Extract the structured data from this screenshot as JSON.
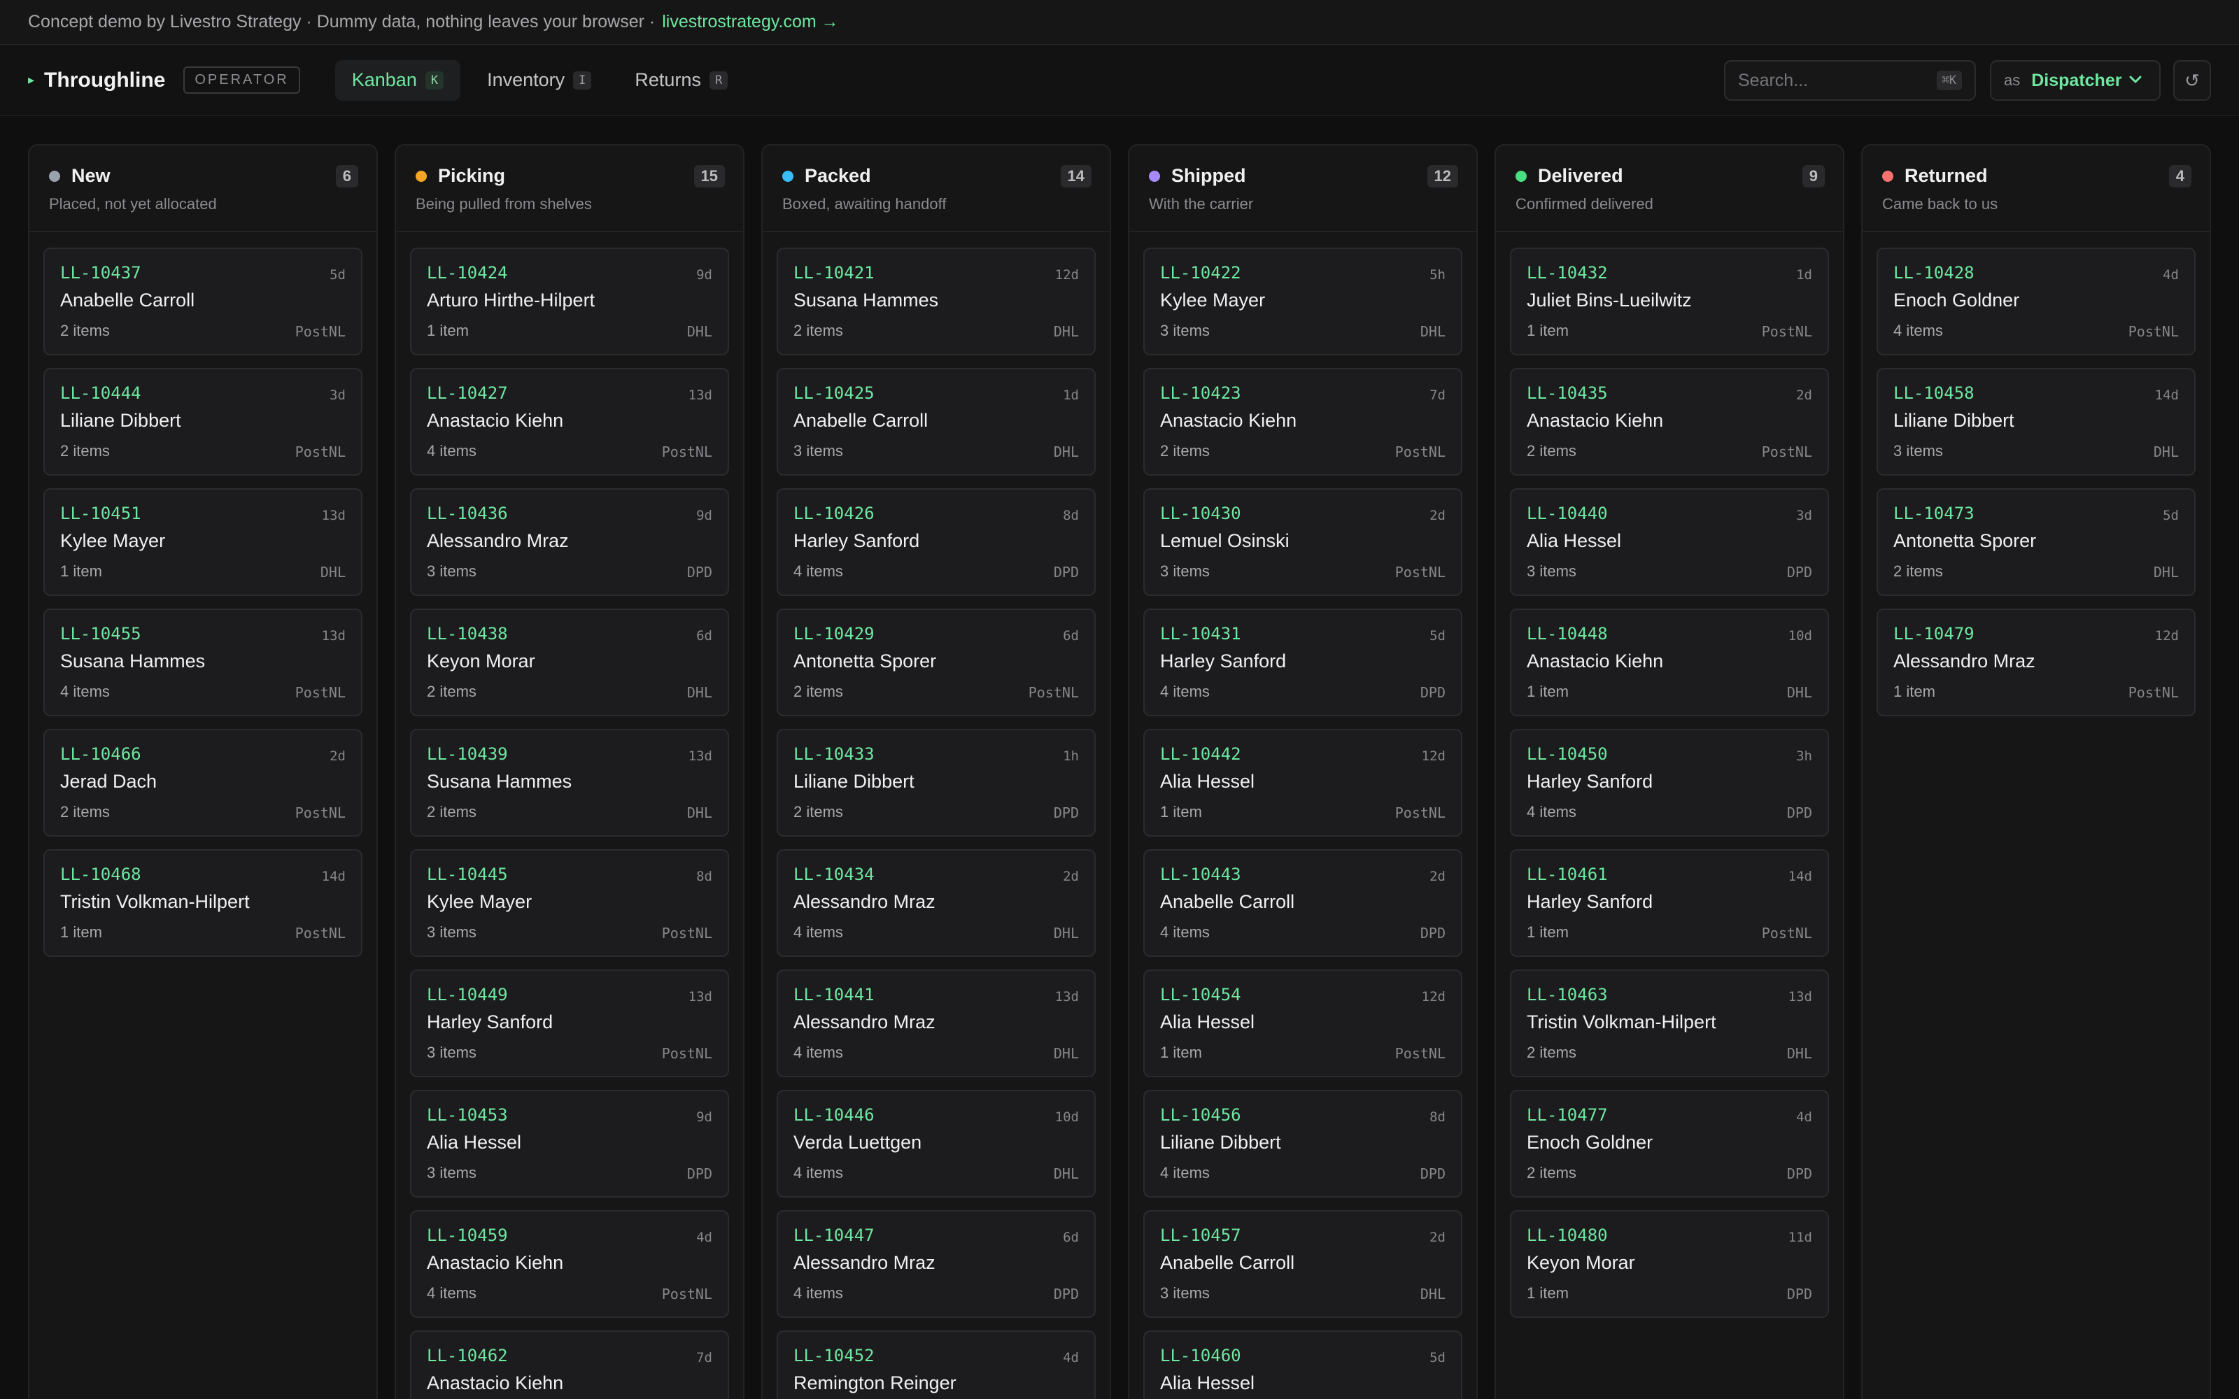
{
  "banner": {
    "text": "Concept demo by Livestro Strategy · Dummy data, nothing leaves your browser ·",
    "link": "livestrostrategy.com →"
  },
  "header": {
    "brand": "Throughline",
    "role_badge": "OPERATOR",
    "tabs": [
      {
        "label": "Kanban",
        "shortcut": "K",
        "active": true
      },
      {
        "label": "Inventory",
        "shortcut": "I",
        "active": false
      },
      {
        "label": "Returns",
        "shortcut": "R",
        "active": false
      }
    ],
    "search": {
      "placeholder": "Search...",
      "shortcut": "⌘K"
    },
    "role_select": {
      "prefix": "as",
      "value": "Dispatcher"
    },
    "refresh_icon": "↺"
  },
  "colors": {
    "accent": "#6ee7a0",
    "new": "#9aa3ad",
    "picking": "#f5a524",
    "packed": "#38bdf8",
    "shipped": "#a78bfa",
    "delivered": "#4ade80",
    "returned": "#f87171"
  },
  "columns": [
    {
      "title": "New",
      "count": "6",
      "subtitle": "Placed, not yet allocated",
      "color": "#9aa3ad",
      "cards": [
        {
          "id": "LL-10437",
          "age": "5d",
          "name": "Anabelle Carroll",
          "items": "2 items",
          "carrier": "PostNL"
        },
        {
          "id": "LL-10444",
          "age": "3d",
          "name": "Liliane Dibbert",
          "items": "2 items",
          "carrier": "PostNL"
        },
        {
          "id": "LL-10451",
          "age": "13d",
          "name": "Kylee Mayer",
          "items": "1 item",
          "carrier": "DHL"
        },
        {
          "id": "LL-10455",
          "age": "13d",
          "name": "Susana Hammes",
          "items": "4 items",
          "carrier": "PostNL"
        },
        {
          "id": "LL-10466",
          "age": "2d",
          "name": "Jerad Dach",
          "items": "2 items",
          "carrier": "PostNL"
        },
        {
          "id": "LL-10468",
          "age": "14d",
          "name": "Tristin Volkman-Hilpert",
          "items": "1 item",
          "carrier": "PostNL"
        }
      ]
    },
    {
      "title": "Picking",
      "count": "15",
      "subtitle": "Being pulled from shelves",
      "color": "#f5a524",
      "cards": [
        {
          "id": "LL-10424",
          "age": "9d",
          "name": "Arturo Hirthe-Hilpert",
          "items": "1 item",
          "carrier": "DHL"
        },
        {
          "id": "LL-10427",
          "age": "13d",
          "name": "Anastacio Kiehn",
          "items": "4 items",
          "carrier": "PostNL"
        },
        {
          "id": "LL-10436",
          "age": "9d",
          "name": "Alessandro Mraz",
          "items": "3 items",
          "carrier": "DPD"
        },
        {
          "id": "LL-10438",
          "age": "6d",
          "name": "Keyon Morar",
          "items": "2 items",
          "carrier": "DHL"
        },
        {
          "id": "LL-10439",
          "age": "13d",
          "name": "Susana Hammes",
          "items": "2 items",
          "carrier": "DHL"
        },
        {
          "id": "LL-10445",
          "age": "8d",
          "name": "Kylee Mayer",
          "items": "3 items",
          "carrier": "PostNL"
        },
        {
          "id": "LL-10449",
          "age": "13d",
          "name": "Harley Sanford",
          "items": "3 items",
          "carrier": "PostNL"
        },
        {
          "id": "LL-10453",
          "age": "9d",
          "name": "Alia Hessel",
          "items": "3 items",
          "carrier": "DPD"
        },
        {
          "id": "LL-10459",
          "age": "4d",
          "name": "Anastacio Kiehn",
          "items": "4 items",
          "carrier": "PostNL"
        },
        {
          "id": "LL-10462",
          "age": "7d",
          "name": "Anastacio Kiehn",
          "items": "",
          "carrier": ""
        }
      ]
    },
    {
      "title": "Packed",
      "count": "14",
      "subtitle": "Boxed, awaiting handoff",
      "color": "#38bdf8",
      "cards": [
        {
          "id": "LL-10421",
          "age": "12d",
          "name": "Susana Hammes",
          "items": "2 items",
          "carrier": "DHL"
        },
        {
          "id": "LL-10425",
          "age": "1d",
          "name": "Anabelle Carroll",
          "items": "3 items",
          "carrier": "DHL"
        },
        {
          "id": "LL-10426",
          "age": "8d",
          "name": "Harley Sanford",
          "items": "4 items",
          "carrier": "DPD"
        },
        {
          "id": "LL-10429",
          "age": "6d",
          "name": "Antonetta Sporer",
          "items": "2 items",
          "carrier": "PostNL"
        },
        {
          "id": "LL-10433",
          "age": "1h",
          "name": "Liliane Dibbert",
          "items": "2 items",
          "carrier": "DPD"
        },
        {
          "id": "LL-10434",
          "age": "2d",
          "name": "Alessandro Mraz",
          "items": "4 items",
          "carrier": "DHL"
        },
        {
          "id": "LL-10441",
          "age": "13d",
          "name": "Alessandro Mraz",
          "items": "4 items",
          "carrier": "DHL"
        },
        {
          "id": "LL-10446",
          "age": "10d",
          "name": "Verda Luettgen",
          "items": "4 items",
          "carrier": "DHL"
        },
        {
          "id": "LL-10447",
          "age": "6d",
          "name": "Alessandro Mraz",
          "items": "4 items",
          "carrier": "DPD"
        },
        {
          "id": "LL-10452",
          "age": "4d",
          "name": "Remington Reinger",
          "items": "",
          "carrier": ""
        }
      ]
    },
    {
      "title": "Shipped",
      "count": "12",
      "subtitle": "With the carrier",
      "color": "#a78bfa",
      "cards": [
        {
          "id": "LL-10422",
          "age": "5h",
          "name": "Kylee Mayer",
          "items": "3 items",
          "carrier": "DHL"
        },
        {
          "id": "LL-10423",
          "age": "7d",
          "name": "Anastacio Kiehn",
          "items": "2 items",
          "carrier": "PostNL"
        },
        {
          "id": "LL-10430",
          "age": "2d",
          "name": "Lemuel Osinski",
          "items": "3 items",
          "carrier": "PostNL"
        },
        {
          "id": "LL-10431",
          "age": "5d",
          "name": "Harley Sanford",
          "items": "4 items",
          "carrier": "DPD"
        },
        {
          "id": "LL-10442",
          "age": "12d",
          "name": "Alia Hessel",
          "items": "1 item",
          "carrier": "PostNL"
        },
        {
          "id": "LL-10443",
          "age": "2d",
          "name": "Anabelle Carroll",
          "items": "4 items",
          "carrier": "DPD"
        },
        {
          "id": "LL-10454",
          "age": "12d",
          "name": "Alia Hessel",
          "items": "1 item",
          "carrier": "PostNL"
        },
        {
          "id": "LL-10456",
          "age": "8d",
          "name": "Liliane Dibbert",
          "items": "4 items",
          "carrier": "DPD"
        },
        {
          "id": "LL-10457",
          "age": "2d",
          "name": "Anabelle Carroll",
          "items": "3 items",
          "carrier": "DHL"
        },
        {
          "id": "LL-10460",
          "age": "5d",
          "name": "Alia Hessel",
          "items": "",
          "carrier": ""
        }
      ]
    },
    {
      "title": "Delivered",
      "count": "9",
      "subtitle": "Confirmed delivered",
      "color": "#4ade80",
      "cards": [
        {
          "id": "LL-10432",
          "age": "1d",
          "name": "Juliet Bins-Lueilwitz",
          "items": "1 item",
          "carrier": "PostNL"
        },
        {
          "id": "LL-10435",
          "age": "2d",
          "name": "Anastacio Kiehn",
          "items": "2 items",
          "carrier": "PostNL"
        },
        {
          "id": "LL-10440",
          "age": "3d",
          "name": "Alia Hessel",
          "items": "3 items",
          "carrier": "DPD"
        },
        {
          "id": "LL-10448",
          "age": "10d",
          "name": "Anastacio Kiehn",
          "items": "1 item",
          "carrier": "DHL"
        },
        {
          "id": "LL-10450",
          "age": "3h",
          "name": "Harley Sanford",
          "items": "4 items",
          "carrier": "DPD"
        },
        {
          "id": "LL-10461",
          "age": "14d",
          "name": "Harley Sanford",
          "items": "1 item",
          "carrier": "PostNL"
        },
        {
          "id": "LL-10463",
          "age": "13d",
          "name": "Tristin Volkman-Hilpert",
          "items": "2 items",
          "carrier": "DHL"
        },
        {
          "id": "LL-10477",
          "age": "4d",
          "name": "Enoch Goldner",
          "items": "2 items",
          "carrier": "DPD"
        },
        {
          "id": "LL-10480",
          "age": "11d",
          "name": "Keyon Morar",
          "items": "1 item",
          "carrier": "DPD"
        }
      ]
    },
    {
      "title": "Returned",
      "count": "4",
      "subtitle": "Came back to us",
      "color": "#f87171",
      "cards": [
        {
          "id": "LL-10428",
          "age": "4d",
          "name": "Enoch Goldner",
          "items": "4 items",
          "carrier": "PostNL"
        },
        {
          "id": "LL-10458",
          "age": "14d",
          "name": "Liliane Dibbert",
          "items": "3 items",
          "carrier": "DHL"
        },
        {
          "id": "LL-10473",
          "age": "5d",
          "name": "Antonetta Sporer",
          "items": "2 items",
          "carrier": "DHL"
        },
        {
          "id": "LL-10479",
          "age": "12d",
          "name": "Alessandro Mraz",
          "items": "1 item",
          "carrier": "PostNL"
        }
      ]
    }
  ]
}
